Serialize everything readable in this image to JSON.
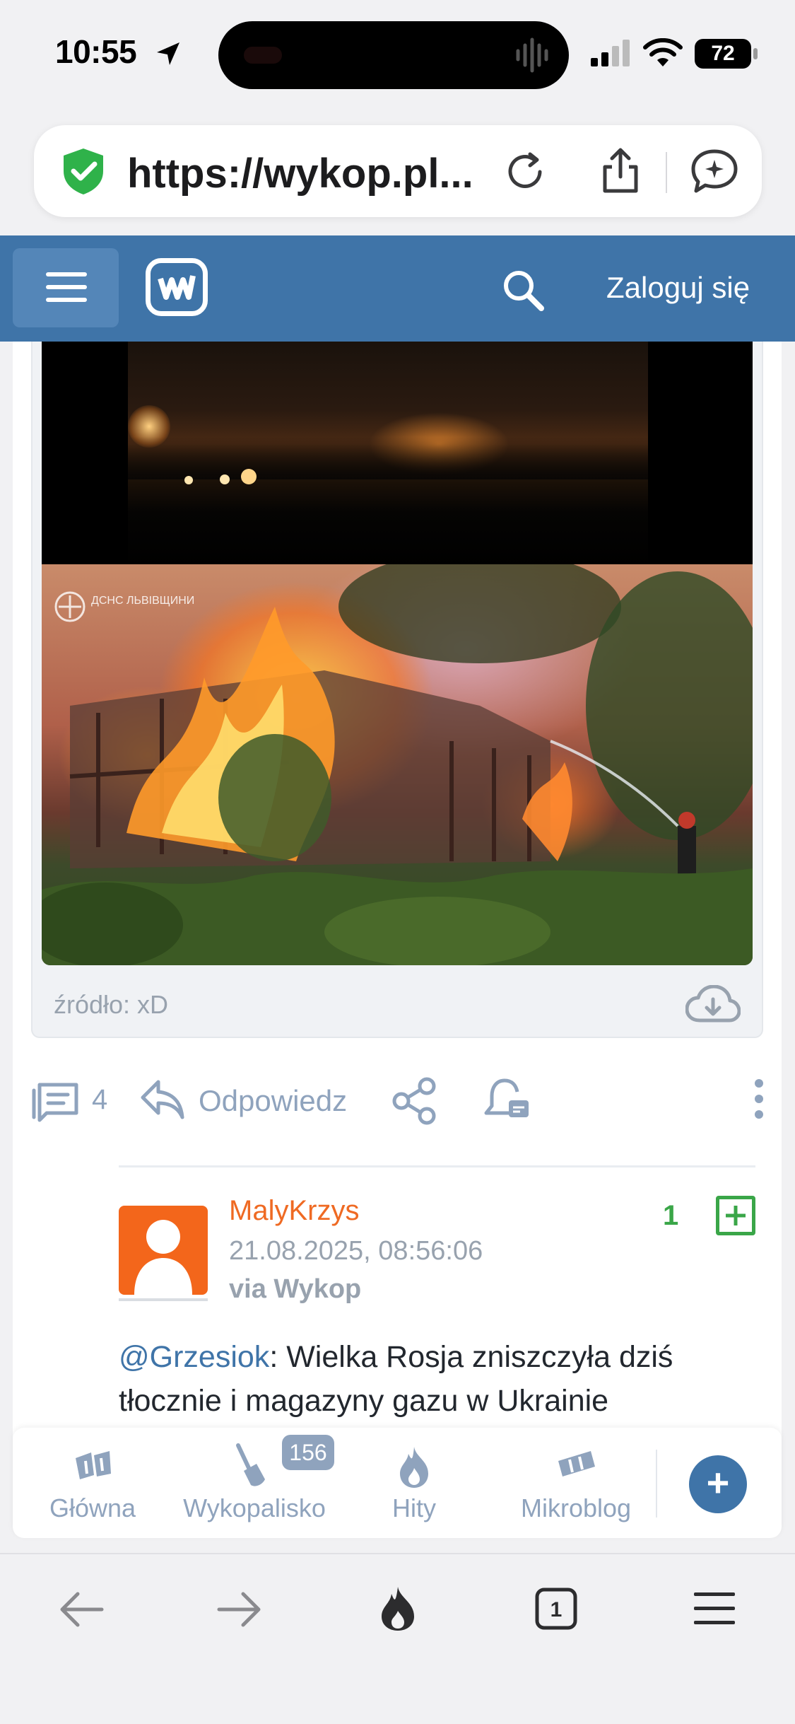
{
  "status_bar": {
    "time": "10:55",
    "battery": "72"
  },
  "browser": {
    "url": "https://wykop.pl..."
  },
  "header": {
    "login": "Zaloguj się"
  },
  "media": {
    "source_label": "źródło: xD",
    "overlay_text": "ДСНС ЛЬВІВЩИНИ"
  },
  "actions": {
    "comment_count": "4",
    "reply_label": "Odpowiedz"
  },
  "comment": {
    "username": "MalyKrzys",
    "timestamp": "21.08.2025, 08:56:06",
    "via": "via Wykop",
    "votes": "1",
    "mention": "@Grzesiok",
    "text_after_mention": ": Wielka Rosja zniszczyła dziś tłocznie i magazyny gazu w Ukrainie"
  },
  "bottom_nav": {
    "items": [
      {
        "label": "Główna",
        "icon": "wykop-home-icon"
      },
      {
        "label": "Wykopalisko",
        "icon": "shovel-icon",
        "badge": "156"
      },
      {
        "label": "Hity",
        "icon": "flame-icon"
      },
      {
        "label": "Mikroblog",
        "icon": "mikroblog-icon"
      }
    ],
    "add_label": "+"
  },
  "colors": {
    "brand": "#3f74a8",
    "accent": "#ef6a23",
    "vote_green": "#3aa648",
    "muted": "#8fa3bd"
  }
}
